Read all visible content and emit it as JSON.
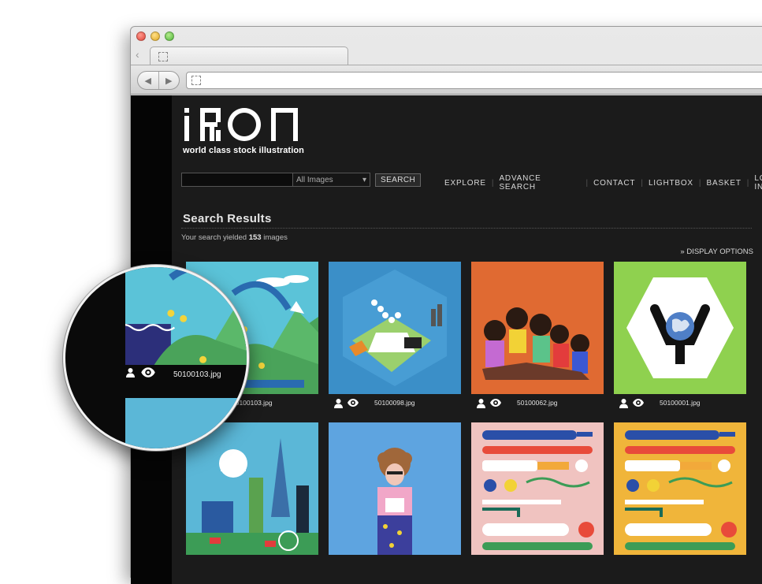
{
  "brand": {
    "logo_text": "ikon",
    "tagline": "world class stock illustration"
  },
  "search": {
    "placeholder": "",
    "category": "All Images",
    "button": "SEARCH"
  },
  "nav": [
    "EXPLORE",
    "ADVANCE SEARCH",
    "CONTACT",
    "LIGHTBOX",
    "BASKET",
    "LOG IN"
  ],
  "results": {
    "title": "Search Results",
    "count_prefix": "Your search yielded",
    "count": "153",
    "count_suffix": "images",
    "display_options": "» DISPLAY OPTIONS"
  },
  "thumbnails": [
    {
      "file": "50100103.jpg",
      "art": "landscape",
      "bg": "#5bc3d8"
    },
    {
      "file": "50100098.jpg",
      "art": "hexagons",
      "bg": "#3b8fc8"
    },
    {
      "file": "50100062.jpg",
      "art": "dancers",
      "bg": "#e06a32"
    },
    {
      "file": "50100001.jpg",
      "art": "globe",
      "bg": "#8fd14f"
    },
    {
      "file": "",
      "art": "city",
      "bg": "#5bb7d7"
    },
    {
      "file": "",
      "art": "person",
      "bg": "#5ea4e0"
    },
    {
      "file": "",
      "art": "medical-pink",
      "bg": "#f0c3c0"
    },
    {
      "file": "",
      "art": "medical-yellow",
      "bg": "#f0b53a"
    }
  ],
  "magnifier": {
    "file": "50100103.jpg"
  },
  "icons": {
    "user": "user-icon",
    "view": "eye-icon"
  }
}
